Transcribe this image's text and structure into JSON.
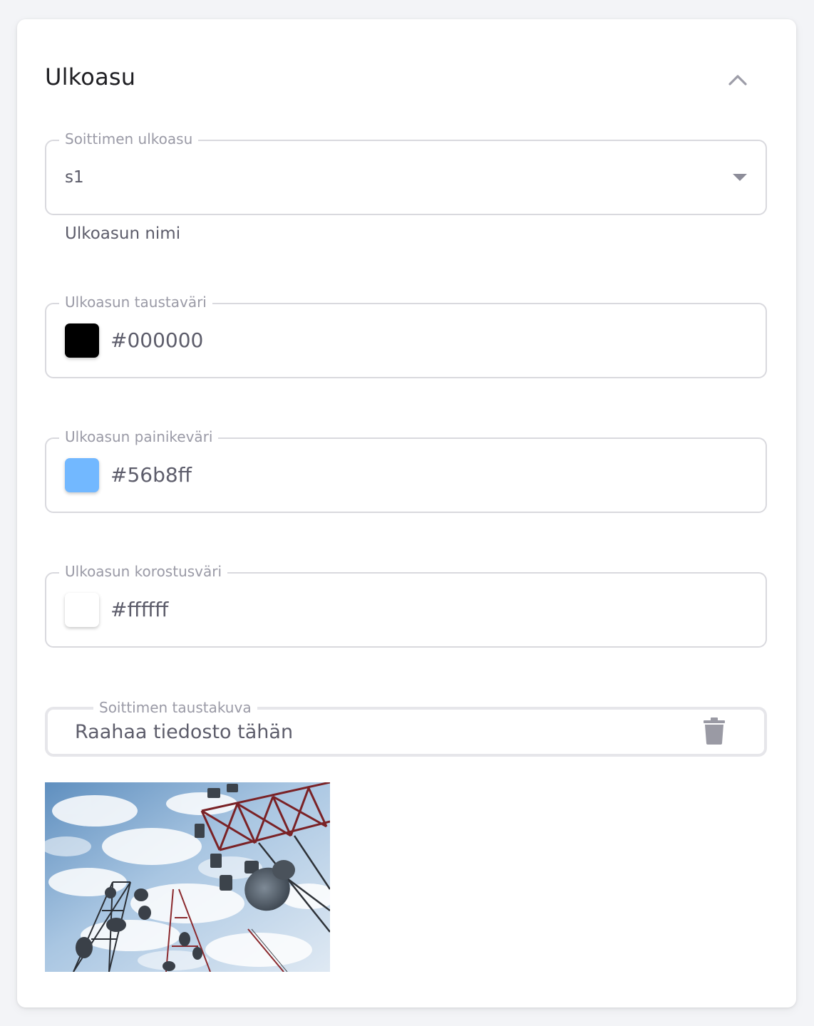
{
  "section": {
    "title": "Ulkoasu"
  },
  "player_layout": {
    "label": "Soittimen ulkoasu",
    "value": "s1",
    "helper": "Ulkoasun nimi"
  },
  "background_color": {
    "label": "Ulkoasun taustaväri",
    "value": "#000000",
    "swatch": "#000000"
  },
  "button_color": {
    "label": "Ulkoasun painikeväri",
    "value": "#56b8ff",
    "swatch": "#72b8ff"
  },
  "highlight_color": {
    "label": "Ulkoasun korostusväri",
    "value": "#ffffff",
    "swatch": "#ffffff"
  },
  "background_image": {
    "label": "Soittimen taustakuva",
    "prompt": "Raahaa tiedosto tähän"
  },
  "icons": {
    "collapse": "chevron-up-icon",
    "dropdown": "caret-down-icon",
    "delete": "trash-icon"
  }
}
